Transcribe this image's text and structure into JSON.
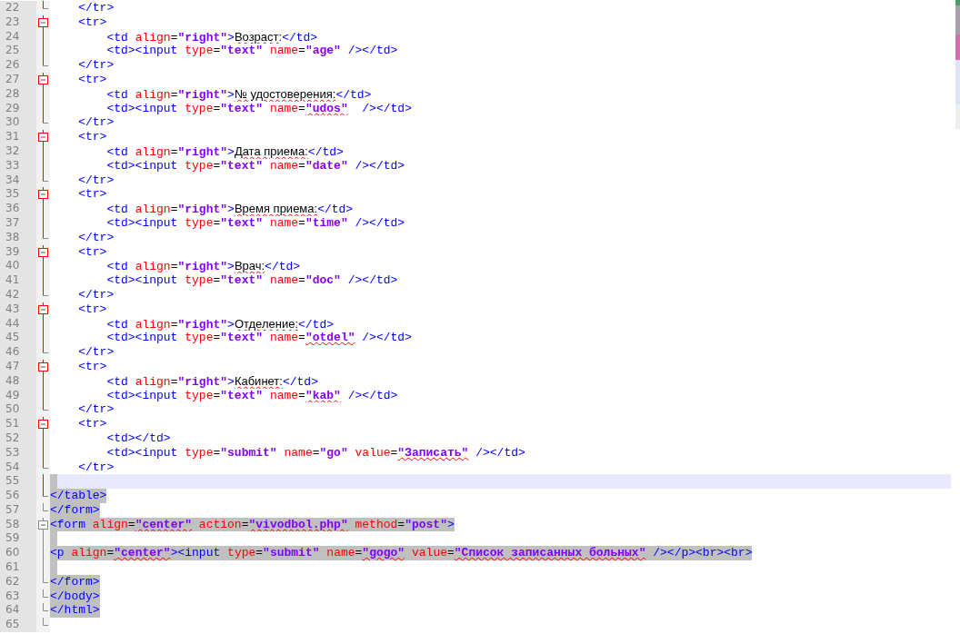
{
  "editor": {
    "lines": [
      {
        "number": "22",
        "kind": "end",
        "active_fold": true,
        "selected": false,
        "current": false,
        "tokens": [
          {
            "kind": "tag",
            "text": "    </tr>"
          }
        ]
      },
      {
        "number": "23",
        "kind": "open",
        "active_fold": true,
        "selected": false,
        "current": false,
        "tokens": [
          {
            "kind": "tag",
            "text": "    <tr>"
          }
        ]
      },
      {
        "number": "24",
        "kind": "line",
        "active_fold": true,
        "selected": false,
        "current": false,
        "tokens": [
          {
            "kind": "tag",
            "text": "        <td "
          },
          {
            "kind": "attr",
            "text": "align"
          },
          {
            "kind": "op",
            "text": "="
          },
          {
            "kind": "val",
            "text": "\"right\""
          },
          {
            "kind": "tag",
            "text": ">"
          },
          {
            "kind": "txtx",
            "text": "Возраст:"
          },
          {
            "kind": "tag",
            "text": "</td>"
          }
        ]
      },
      {
        "number": "25",
        "kind": "line",
        "active_fold": true,
        "selected": false,
        "current": false,
        "tokens": [
          {
            "kind": "tag",
            "text": "        <td><input "
          },
          {
            "kind": "attr",
            "text": "type"
          },
          {
            "kind": "op",
            "text": "="
          },
          {
            "kind": "val",
            "text": "\"text\""
          },
          {
            "kind": "attr",
            "text": " name"
          },
          {
            "kind": "op",
            "text": "="
          },
          {
            "kind": "val",
            "text": "\"age\""
          },
          {
            "kind": "tag",
            "text": " /></td>"
          }
        ]
      },
      {
        "number": "26",
        "kind": "end",
        "active_fold": true,
        "selected": false,
        "current": false,
        "tokens": [
          {
            "kind": "tag",
            "text": "    </tr>"
          }
        ]
      },
      {
        "number": "27",
        "kind": "open",
        "active_fold": true,
        "selected": false,
        "current": false,
        "tokens": [
          {
            "kind": "tag",
            "text": "    <tr>"
          }
        ]
      },
      {
        "number": "28",
        "kind": "line",
        "active_fold": true,
        "selected": false,
        "current": false,
        "tokens": [
          {
            "kind": "tag",
            "text": "        <td "
          },
          {
            "kind": "attr",
            "text": "align"
          },
          {
            "kind": "op",
            "text": "="
          },
          {
            "kind": "val",
            "text": "\"right\""
          },
          {
            "kind": "tag",
            "text": ">"
          },
          {
            "kind": "txtx",
            "text": "№ удостоверения:"
          },
          {
            "kind": "tag",
            "text": "</td>"
          }
        ]
      },
      {
        "number": "29",
        "kind": "line",
        "active_fold": true,
        "selected": false,
        "current": false,
        "tokens": [
          {
            "kind": "tag",
            "text": "        <td><input "
          },
          {
            "kind": "attr",
            "text": "type"
          },
          {
            "kind": "op",
            "text": "="
          },
          {
            "kind": "val",
            "text": "\"text\""
          },
          {
            "kind": "attr",
            "text": " name"
          },
          {
            "kind": "op",
            "text": "="
          },
          {
            "kind": "valx",
            "text": "\"udos\""
          },
          {
            "kind": "tag",
            "text": "  /></td>"
          }
        ]
      },
      {
        "number": "30",
        "kind": "end",
        "active_fold": true,
        "selected": false,
        "current": false,
        "tokens": [
          {
            "kind": "tag",
            "text": "    </tr>"
          }
        ]
      },
      {
        "number": "31",
        "kind": "open",
        "active_fold": true,
        "selected": false,
        "current": false,
        "tokens": [
          {
            "kind": "tag",
            "text": "    <tr>"
          }
        ]
      },
      {
        "number": "32",
        "kind": "line",
        "active_fold": true,
        "selected": false,
        "current": false,
        "tokens": [
          {
            "kind": "tag",
            "text": "        <td "
          },
          {
            "kind": "attr",
            "text": "align"
          },
          {
            "kind": "op",
            "text": "="
          },
          {
            "kind": "val",
            "text": "\"right\""
          },
          {
            "kind": "tag",
            "text": ">"
          },
          {
            "kind": "txtx",
            "text": "Дата приема:"
          },
          {
            "kind": "tag",
            "text": "</td>"
          }
        ]
      },
      {
        "number": "33",
        "kind": "line",
        "active_fold": true,
        "selected": false,
        "current": false,
        "tokens": [
          {
            "kind": "tag",
            "text": "        <td><input "
          },
          {
            "kind": "attr",
            "text": "type"
          },
          {
            "kind": "op",
            "text": "="
          },
          {
            "kind": "val",
            "text": "\"text\""
          },
          {
            "kind": "attr",
            "text": " name"
          },
          {
            "kind": "op",
            "text": "="
          },
          {
            "kind": "val",
            "text": "\"date\""
          },
          {
            "kind": "tag",
            "text": " /></td>"
          }
        ]
      },
      {
        "number": "34",
        "kind": "end",
        "active_fold": true,
        "selected": false,
        "current": false,
        "tokens": [
          {
            "kind": "tag",
            "text": "    </tr>"
          }
        ]
      },
      {
        "number": "35",
        "kind": "open",
        "active_fold": true,
        "selected": false,
        "current": false,
        "tokens": [
          {
            "kind": "tag",
            "text": "    <tr>"
          }
        ]
      },
      {
        "number": "36",
        "kind": "line",
        "active_fold": true,
        "selected": false,
        "current": false,
        "tokens": [
          {
            "kind": "tag",
            "text": "        <td "
          },
          {
            "kind": "attr",
            "text": "align"
          },
          {
            "kind": "op",
            "text": "="
          },
          {
            "kind": "val",
            "text": "\"right\""
          },
          {
            "kind": "tag",
            "text": ">"
          },
          {
            "kind": "txtx",
            "text": "Время приема:"
          },
          {
            "kind": "tag",
            "text": "</td>"
          }
        ]
      },
      {
        "number": "37",
        "kind": "line",
        "active_fold": true,
        "selected": false,
        "current": false,
        "tokens": [
          {
            "kind": "tag",
            "text": "        <td><input "
          },
          {
            "kind": "attr",
            "text": "type"
          },
          {
            "kind": "op",
            "text": "="
          },
          {
            "kind": "val",
            "text": "\"text\""
          },
          {
            "kind": "attr",
            "text": " name"
          },
          {
            "kind": "op",
            "text": "="
          },
          {
            "kind": "val",
            "text": "\"time\""
          },
          {
            "kind": "tag",
            "text": " /></td>"
          }
        ]
      },
      {
        "number": "38",
        "kind": "end",
        "active_fold": true,
        "selected": false,
        "current": false,
        "tokens": [
          {
            "kind": "tag",
            "text": "    </tr>"
          }
        ]
      },
      {
        "number": "39",
        "kind": "open",
        "active_fold": true,
        "selected": false,
        "current": false,
        "tokens": [
          {
            "kind": "tag",
            "text": "    <tr>"
          }
        ]
      },
      {
        "number": "40",
        "kind": "line",
        "active_fold": true,
        "selected": false,
        "current": false,
        "tokens": [
          {
            "kind": "tag",
            "text": "        <td "
          },
          {
            "kind": "attr",
            "text": "align"
          },
          {
            "kind": "op",
            "text": "="
          },
          {
            "kind": "val",
            "text": "\"right\""
          },
          {
            "kind": "tag",
            "text": ">"
          },
          {
            "kind": "txtx",
            "text": "Врач:"
          },
          {
            "kind": "tag",
            "text": "</td>"
          }
        ]
      },
      {
        "number": "41",
        "kind": "line",
        "active_fold": true,
        "selected": false,
        "current": false,
        "tokens": [
          {
            "kind": "tag",
            "text": "        <td><input "
          },
          {
            "kind": "attr",
            "text": "type"
          },
          {
            "kind": "op",
            "text": "="
          },
          {
            "kind": "val",
            "text": "\"text\""
          },
          {
            "kind": "attr",
            "text": " name"
          },
          {
            "kind": "op",
            "text": "="
          },
          {
            "kind": "val",
            "text": "\"doc\""
          },
          {
            "kind": "tag",
            "text": " /></td>"
          }
        ]
      },
      {
        "number": "42",
        "kind": "end",
        "active_fold": true,
        "selected": false,
        "current": false,
        "tokens": [
          {
            "kind": "tag",
            "text": "    </tr>"
          }
        ]
      },
      {
        "number": "43",
        "kind": "open",
        "active_fold": true,
        "selected": false,
        "current": false,
        "tokens": [
          {
            "kind": "tag",
            "text": "    <tr>"
          }
        ]
      },
      {
        "number": "44",
        "kind": "line",
        "active_fold": true,
        "selected": false,
        "current": false,
        "tokens": [
          {
            "kind": "tag",
            "text": "        <td "
          },
          {
            "kind": "attr",
            "text": "align"
          },
          {
            "kind": "op",
            "text": "="
          },
          {
            "kind": "val",
            "text": "\"right\""
          },
          {
            "kind": "tag",
            "text": ">"
          },
          {
            "kind": "txtx",
            "text": "Отделение:"
          },
          {
            "kind": "tag",
            "text": "</td>"
          }
        ]
      },
      {
        "number": "45",
        "kind": "line",
        "active_fold": true,
        "selected": false,
        "current": false,
        "tokens": [
          {
            "kind": "tag",
            "text": "        <td><input "
          },
          {
            "kind": "attr",
            "text": "type"
          },
          {
            "kind": "op",
            "text": "="
          },
          {
            "kind": "val",
            "text": "\"text\""
          },
          {
            "kind": "attr",
            "text": " name"
          },
          {
            "kind": "op",
            "text": "="
          },
          {
            "kind": "valx",
            "text": "\"otdel\""
          },
          {
            "kind": "tag",
            "text": " /></td>"
          }
        ]
      },
      {
        "number": "46",
        "kind": "end",
        "active_fold": true,
        "selected": false,
        "current": false,
        "tokens": [
          {
            "kind": "tag",
            "text": "    </tr>"
          }
        ]
      },
      {
        "number": "47",
        "kind": "open",
        "active_fold": true,
        "selected": false,
        "current": false,
        "tokens": [
          {
            "kind": "tag",
            "text": "    <tr>"
          }
        ]
      },
      {
        "number": "48",
        "kind": "line",
        "active_fold": true,
        "selected": false,
        "current": false,
        "tokens": [
          {
            "kind": "tag",
            "text": "        <td "
          },
          {
            "kind": "attr",
            "text": "align"
          },
          {
            "kind": "op",
            "text": "="
          },
          {
            "kind": "val",
            "text": "\"right\""
          },
          {
            "kind": "tag",
            "text": ">"
          },
          {
            "kind": "txtx",
            "text": "Кабинет:"
          },
          {
            "kind": "tag",
            "text": "</td>"
          }
        ]
      },
      {
        "number": "49",
        "kind": "line",
        "active_fold": true,
        "selected": false,
        "current": false,
        "tokens": [
          {
            "kind": "tag",
            "text": "        <td><input "
          },
          {
            "kind": "attr",
            "text": "type"
          },
          {
            "kind": "op",
            "text": "="
          },
          {
            "kind": "val",
            "text": "\"text\""
          },
          {
            "kind": "attr",
            "text": " name"
          },
          {
            "kind": "op",
            "text": "="
          },
          {
            "kind": "valx",
            "text": "\"kab\""
          },
          {
            "kind": "tag",
            "text": " /></td>"
          }
        ]
      },
      {
        "number": "50",
        "kind": "end",
        "active_fold": true,
        "selected": false,
        "current": false,
        "tokens": [
          {
            "kind": "tag",
            "text": "    </tr>"
          }
        ]
      },
      {
        "number": "51",
        "kind": "open",
        "active_fold": true,
        "selected": false,
        "current": false,
        "tokens": [
          {
            "kind": "tag",
            "text": "    <tr>"
          }
        ]
      },
      {
        "number": "52",
        "kind": "line",
        "active_fold": true,
        "selected": false,
        "current": false,
        "tokens": [
          {
            "kind": "tag",
            "text": "        <td></td>"
          }
        ]
      },
      {
        "number": "53",
        "kind": "line",
        "active_fold": true,
        "selected": false,
        "current": false,
        "tokens": [
          {
            "kind": "tag",
            "text": "        <td><input "
          },
          {
            "kind": "attr",
            "text": "type"
          },
          {
            "kind": "op",
            "text": "="
          },
          {
            "kind": "val",
            "text": "\"submit\""
          },
          {
            "kind": "attr",
            "text": " name"
          },
          {
            "kind": "op",
            "text": "="
          },
          {
            "kind": "val",
            "text": "\"go\""
          },
          {
            "kind": "attr",
            "text": " value"
          },
          {
            "kind": "op",
            "text": "="
          },
          {
            "kind": "valx",
            "text": "\"Записать\""
          },
          {
            "kind": "tag",
            "text": " /></td>"
          }
        ]
      },
      {
        "number": "54",
        "kind": "end",
        "active_fold": true,
        "selected": false,
        "current": false,
        "tokens": [
          {
            "kind": "tag",
            "text": "    </tr>"
          }
        ]
      },
      {
        "number": "55",
        "kind": "line",
        "active_fold": true,
        "selected": true,
        "current": true
      },
      {
        "number": "56",
        "kind": "end",
        "active_fold": true,
        "selected": true,
        "current": false,
        "tokens": [
          {
            "kind": "tag",
            "text": "</table>"
          }
        ]
      },
      {
        "number": "57",
        "kind": "end",
        "active_fold": false,
        "selected": true,
        "current": false,
        "tokens": [
          {
            "kind": "tag",
            "text": "</form>"
          }
        ]
      },
      {
        "number": "58",
        "kind": "open",
        "active_fold": false,
        "selected": true,
        "current": false,
        "tokens": [
          {
            "kind": "tag",
            "text": "<form "
          },
          {
            "kind": "attr",
            "text": "align"
          },
          {
            "kind": "op",
            "text": "="
          },
          {
            "kind": "valx",
            "text": "\"center\""
          },
          {
            "kind": "attr",
            "text": " action"
          },
          {
            "kind": "op",
            "text": "="
          },
          {
            "kind": "valx",
            "text": "\"vivodbol.php\""
          },
          {
            "kind": "attr",
            "text": " method"
          },
          {
            "kind": "op",
            "text": "="
          },
          {
            "kind": "val",
            "text": "\"post\""
          },
          {
            "kind": "tag",
            "text": ">"
          }
        ]
      },
      {
        "number": "59",
        "kind": "line",
        "active_fold": false,
        "selected": true,
        "current": false
      },
      {
        "number": "60",
        "kind": "line",
        "active_fold": false,
        "selected": true,
        "current": false,
        "tokens": [
          {
            "kind": "tag",
            "text": "<p "
          },
          {
            "kind": "attr",
            "text": "align"
          },
          {
            "kind": "op",
            "text": "="
          },
          {
            "kind": "valx",
            "text": "\"center\""
          },
          {
            "kind": "tag",
            "text": "><input "
          },
          {
            "kind": "attr",
            "text": "type"
          },
          {
            "kind": "op",
            "text": "="
          },
          {
            "kind": "val",
            "text": "\"submit\""
          },
          {
            "kind": "attr",
            "text": " name"
          },
          {
            "kind": "op",
            "text": "="
          },
          {
            "kind": "valx",
            "text": "\"gogo\""
          },
          {
            "kind": "attr",
            "text": " value"
          },
          {
            "kind": "op",
            "text": "="
          },
          {
            "kind": "valx",
            "text": "\"Список записанных больных\""
          },
          {
            "kind": "tag",
            "text": " /></p><br><br>"
          }
        ]
      },
      {
        "number": "61",
        "kind": "line",
        "active_fold": false,
        "selected": true,
        "current": false
      },
      {
        "number": "62",
        "kind": "end",
        "active_fold": false,
        "selected": true,
        "current": false,
        "tokens": [
          {
            "kind": "tag",
            "text": "</form>"
          }
        ]
      },
      {
        "number": "63",
        "kind": "end",
        "active_fold": false,
        "selected": true,
        "current": false,
        "tokens": [
          {
            "kind": "tag",
            "text": "</body>"
          }
        ]
      },
      {
        "number": "64",
        "kind": "end",
        "active_fold": false,
        "selected": true,
        "current": false,
        "tokens": [
          {
            "kind": "tag",
            "text": "</html>"
          }
        ]
      },
      {
        "number": "65",
        "kind": "end",
        "active_fold": false,
        "selected": false,
        "current": false
      }
    ]
  }
}
